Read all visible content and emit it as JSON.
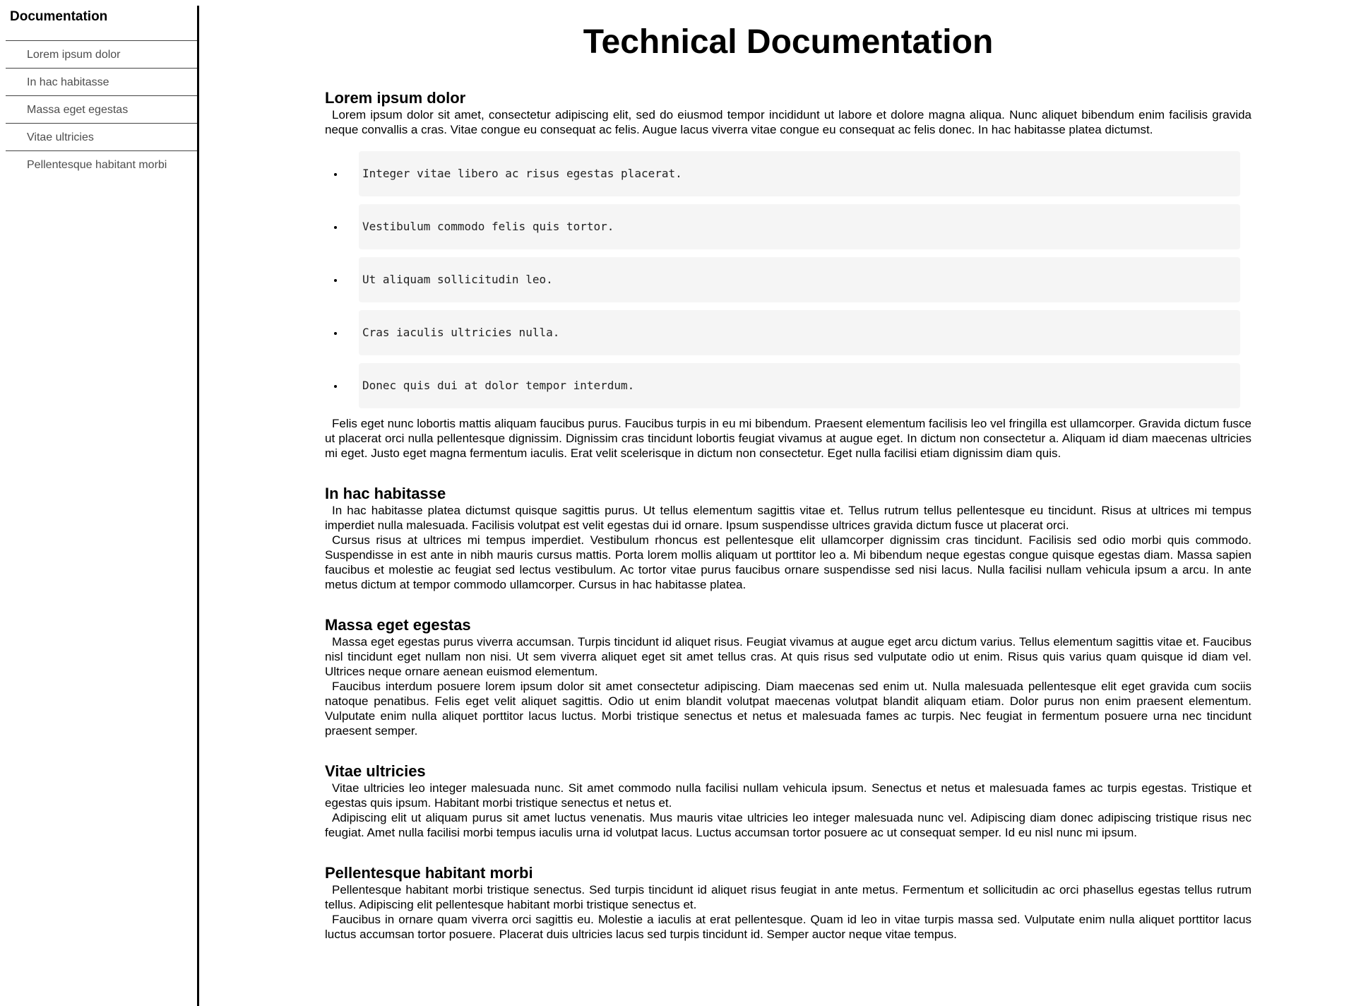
{
  "sidebar": {
    "title": "Documentation",
    "items": [
      {
        "label": "Lorem ipsum dolor"
      },
      {
        "label": "In hac habitasse"
      },
      {
        "label": "Massa eget egestas"
      },
      {
        "label": "Vitae ultricies"
      },
      {
        "label": "Pellentesque habitant morbi"
      }
    ]
  },
  "main": {
    "title": "Technical Documentation",
    "sections": [
      {
        "heading": "Lorem ipsum dolor",
        "p1": "Lorem ipsum dolor sit amet, consectetur adipiscing elit, sed do eiusmod tempor incididunt ut labore et dolore magna aliqua. Nunc aliquet bibendum enim facilisis gravida neque convallis a cras. Vitae congue eu consequat ac felis. Augue lacus viverra vitae congue eu consequat ac felis donec. In hac habitasse platea dictumst.",
        "code": [
          "Integer vitae libero ac risus egestas placerat.",
          "Vestibulum commodo felis quis tortor.",
          "Ut aliquam sollicitudin leo.",
          "Cras iaculis ultricies nulla.",
          "Donec quis dui at dolor tempor interdum."
        ],
        "p2": "Felis eget nunc lobortis mattis aliquam faucibus purus. Faucibus turpis in eu mi bibendum. Praesent elementum facilisis leo vel fringilla est ullamcorper. Gravida dictum fusce ut placerat orci nulla pellentesque dignissim. Dignissim cras tincidunt lobortis feugiat vivamus at augue eget. In dictum non consectetur a. Aliquam id diam maecenas ultricies mi eget. Justo eget magna fermentum iaculis. Erat velit scelerisque in dictum non consectetur. Eget nulla facilisi etiam dignissim diam quis."
      },
      {
        "heading": "In hac habitasse",
        "p1": "In hac habitasse platea dictumst quisque sagittis purus. Ut tellus elementum sagittis vitae et. Tellus rutrum tellus pellentesque eu tincidunt. Risus at ultrices mi tempus imperdiet nulla malesuada. Facilisis volutpat est velit egestas dui id ornare. Ipsum suspendisse ultrices gravida dictum fusce ut placerat orci.",
        "p2": "Cursus risus at ultrices mi tempus imperdiet. Vestibulum rhoncus est pellentesque elit ullamcorper dignissim cras tincidunt. Facilisis sed odio morbi quis commodo. Suspendisse in est ante in nibh mauris cursus mattis. Porta lorem mollis aliquam ut porttitor leo a. Mi bibendum neque egestas congue quisque egestas diam. Massa sapien faucibus et molestie ac feugiat sed lectus vestibulum. Ac tortor vitae purus faucibus ornare suspendisse sed nisi lacus. Nulla facilisi nullam vehicula ipsum a arcu. In ante metus dictum at tempor commodo ullamcorper. Cursus in hac habitasse platea."
      },
      {
        "heading": "Massa eget egestas",
        "p1": "Massa eget egestas purus viverra accumsan. Turpis tincidunt id aliquet risus. Feugiat vivamus at augue eget arcu dictum varius. Tellus elementum sagittis vitae et. Faucibus nisl tincidunt eget nullam non nisi. Ut sem viverra aliquet eget sit amet tellus cras. At quis risus sed vulputate odio ut enim. Risus quis varius quam quisque id diam vel. Ultrices neque ornare aenean euismod elementum.",
        "p2": "Faucibus interdum posuere lorem ipsum dolor sit amet consectetur adipiscing. Diam maecenas sed enim ut. Nulla malesuada pellentesque elit eget gravida cum sociis natoque penatibus. Felis eget velit aliquet sagittis. Odio ut enim blandit volutpat maecenas volutpat blandit aliquam etiam. Dolor purus non enim praesent elementum. Vulputate enim nulla aliquet porttitor lacus luctus. Morbi tristique senectus et netus et malesuada fames ac turpis. Nec feugiat in fermentum posuere urna nec tincidunt praesent semper."
      },
      {
        "heading": "Vitae ultricies",
        "p1": "Vitae ultricies leo integer malesuada nunc. Sit amet commodo nulla facilisi nullam vehicula ipsum. Senectus et netus et malesuada fames ac turpis egestas. Tristique et egestas quis ipsum. Habitant morbi tristique senectus et netus et.",
        "p2": "Adipiscing elit ut aliquam purus sit amet luctus venenatis. Mus mauris vitae ultricies leo integer malesuada nunc vel. Adipiscing diam donec adipiscing tristique risus nec feugiat. Amet nulla facilisi morbi tempus iaculis urna id volutpat lacus. Luctus accumsan tortor posuere ac ut consequat semper. Id eu nisl nunc mi ipsum."
      },
      {
        "heading": "Pellentesque habitant morbi",
        "p1": "Pellentesque habitant morbi tristique senectus. Sed turpis tincidunt id aliquet risus feugiat in ante metus. Fermentum et sollicitudin ac orci phasellus egestas tellus rutrum tellus. Adipiscing elit pellentesque habitant morbi tristique senectus et.",
        "p2": "Faucibus in ornare quam viverra orci sagittis eu. Molestie a iaculis at erat pellentesque. Quam id leo in vitae turpis massa sed. Vulputate enim nulla aliquet porttitor lacus luctus accumsan tortor posuere. Placerat duis ultricies lacus sed turpis tincidunt id. Semper auctor neque vitae tempus."
      }
    ]
  }
}
